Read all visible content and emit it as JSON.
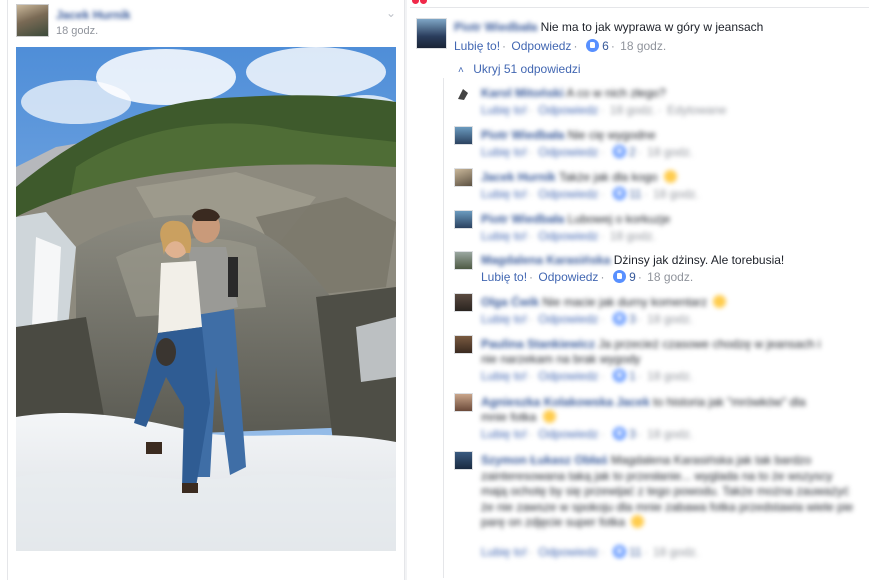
{
  "post": {
    "author_name": "Jacek Hurnik",
    "timestamp": "18 godz.",
    "options_icon": "chevron-down-icon"
  },
  "comments": {
    "main": {
      "author": "Piotr Wiedbała",
      "text": "Nie ma to jak wyprawa w góry w jeansach",
      "like_label": "Lubię to!",
      "reply_label": "Odpowiedz",
      "likes": "6",
      "time": "18 godz."
    },
    "hide_replies_label": "Ukryj 51 odpowiedzi",
    "replies": [
      {
        "author": "Karol Mitoński",
        "text": "A co w nich złego?",
        "like_label": "Lubię to!",
        "reply_label": "Odpowiedz",
        "likes": "",
        "time": "18 godz.",
        "extra": "Edytowane",
        "blurred": true
      },
      {
        "author": "Piotr Wiedbała",
        "text": "Nie cię wygodne",
        "like_label": "Lubię to!",
        "reply_label": "Odpowiedz",
        "likes": "2",
        "time": "18 godz.",
        "blurred": true
      },
      {
        "author": "Jacek Hurnik",
        "text": "Także jak dla kogo",
        "like_label": "Lubię to!",
        "reply_label": "Odpowiedz",
        "likes": "11",
        "time": "18 godz.",
        "blurred": true
      },
      {
        "author": "Piotr Wiedbała",
        "text": "Lubowej o korkuzje",
        "like_label": "Lubię to!",
        "reply_label": "Odpowiedz",
        "likes": "",
        "time": "18 godz.",
        "blurred": true
      },
      {
        "author": "Magdalena Karasińska",
        "text": "Dżinsy jak dżinsy. Ale torebusia!",
        "like_label": "Lubię to!",
        "reply_label": "Odpowiedz",
        "likes": "9",
        "time": "18 godz.",
        "blurred": false
      },
      {
        "author": "Olga Ćwik",
        "text": "Nie macie jak durny komentarz",
        "like_label": "Lubię to!",
        "reply_label": "Odpowiedz",
        "likes": "3",
        "time": "18 godz.",
        "blurred": true
      },
      {
        "author": "Paulina Stankiewicz",
        "text": "Ja przecież czasowe chodzę w jeansach i nie narzekam na brak wygody",
        "like_label": "Lubię to!",
        "reply_label": "Odpowiedz",
        "likes": "1",
        "time": "18 godz.",
        "blurred": true
      },
      {
        "author": "Agnieszka Kolakowska Jacek",
        "text": "to historia jak \"mrówków\" dla mnie fotka",
        "like_label": "Lubię to!",
        "reply_label": "Odpowiedz",
        "likes": "3",
        "time": "18 godz.",
        "blurred": true
      },
      {
        "author": "Szymon Łukasz Obłaś",
        "text": "Magdalena Karasińska jak tak bardzo zainteresowana taką jak to przesłanie... wyglada na to że wszyscy mają ochotę by się przewijać z tego powodu. Także można zauważyć że nie zawsze w spokoju dla mnie zabawa fotka przedstawia wiele pie parę on zdjęcie super fotka",
        "like_label": "Lubię to!",
        "reply_label": "Odpowiedz",
        "likes": "11",
        "time": "18 godz.",
        "blurred": true
      }
    ]
  },
  "colors": {
    "link": "#365899",
    "action": "#4267b2",
    "meta": "#90949c",
    "like_badge": "#5890ff",
    "notification_dot": "#f02849"
  }
}
